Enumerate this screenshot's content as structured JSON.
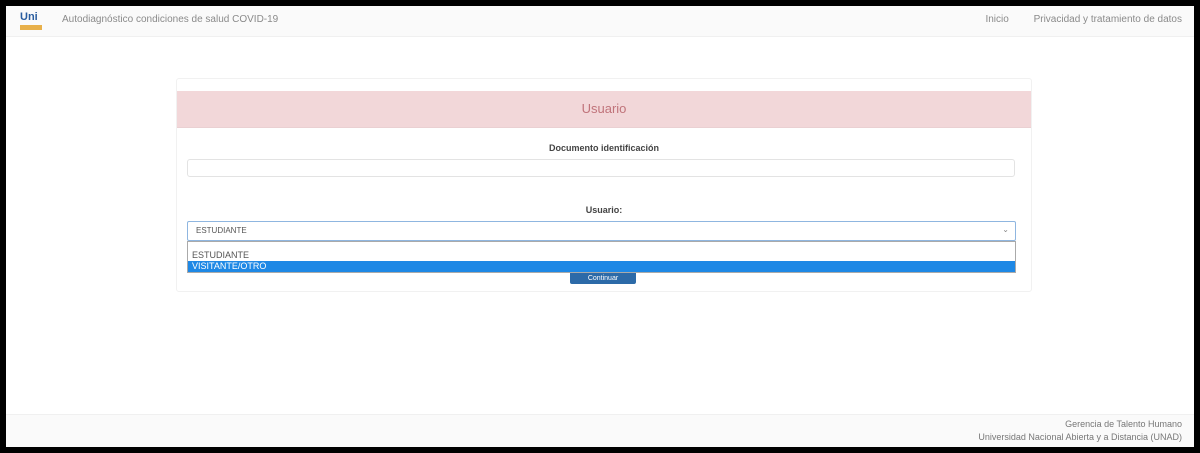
{
  "navbar": {
    "logo_text": "Uni",
    "title": "Autodiagnóstico condiciones de salud COVID-19",
    "links": [
      "Inicio",
      "Privacidad y tratamiento de datos"
    ]
  },
  "card": {
    "header": "Usuario",
    "document_label": "Documento identificación",
    "document_value": "",
    "user_label": "Usuario:",
    "user_selected": "ESTUDIANTE",
    "options": [
      "ESTUDIANTE",
      "VISITANTE/OTRO"
    ],
    "highlighted_option": "VISITANTE/OTRO",
    "submit_label": "Continuar"
  },
  "footer": {
    "line1": "Gerencia de Talento Humano",
    "line2": "Universidad Nacional Abierta y a Distancia (UNAD)"
  },
  "colors": {
    "header_bg": "#f2d7d9",
    "header_text": "#c0737a",
    "highlight": "#1e88e5",
    "button": "#2c6aa8"
  }
}
